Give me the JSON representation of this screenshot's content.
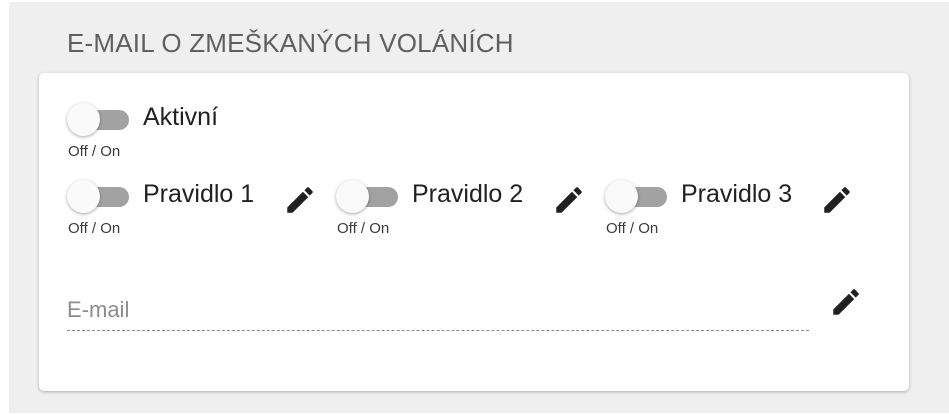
{
  "section": {
    "title": "E-MAIL O ZMEŠKANÝCH VOLÁNÍCH"
  },
  "active_toggle": {
    "label": "Aktivní",
    "hint": "Off / On",
    "state": "off"
  },
  "rules": [
    {
      "label": "Pravidlo 1",
      "hint": "Off / On",
      "state": "off",
      "edit_icon": "pencil-icon"
    },
    {
      "label": "Pravidlo 2",
      "hint": "Off / On",
      "state": "off",
      "edit_icon": "pencil-icon"
    },
    {
      "label": "Pravidlo 3",
      "hint": "Off / On",
      "state": "off",
      "edit_icon": "pencil-icon"
    }
  ],
  "email": {
    "placeholder": "E-mail",
    "value": "",
    "edit_icon": "pencil-icon"
  },
  "colors": {
    "panel_background": "#efefef",
    "card_background": "#ffffff",
    "toggle_track_off": "#a2a2a2",
    "toggle_thumb": "#fafafa",
    "title_text": "#5f5f5f",
    "icon": "#212121"
  }
}
